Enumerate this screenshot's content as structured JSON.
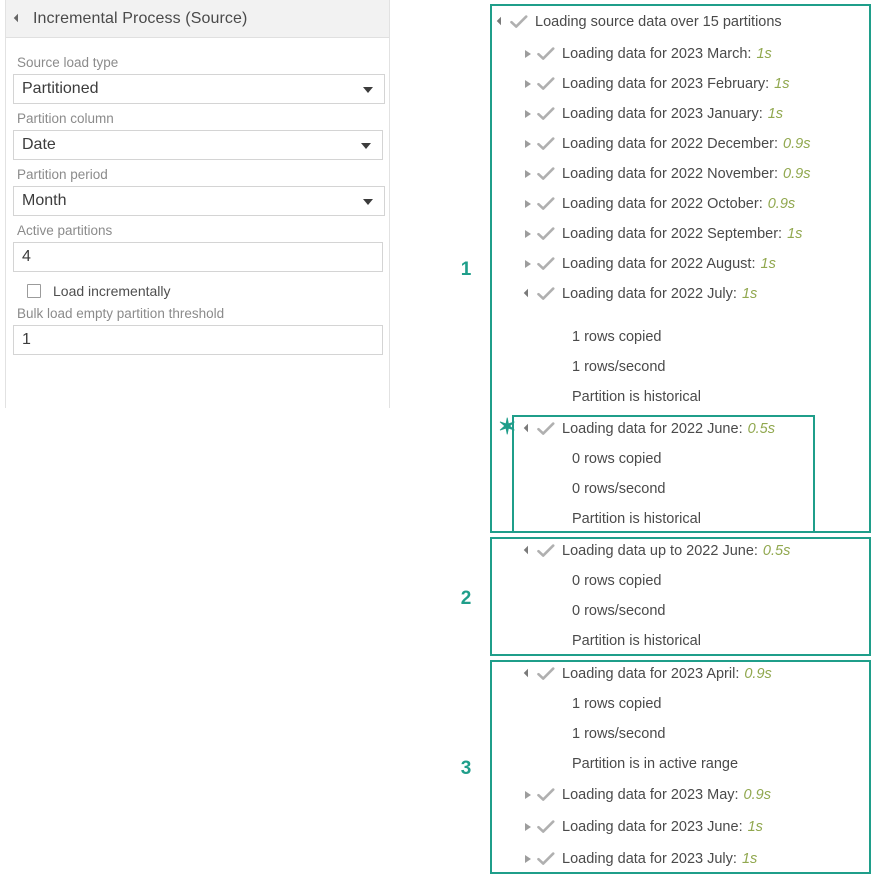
{
  "colors": {
    "accent": "#1f9e8a",
    "duration_text": "#91a84f",
    "label_text": "#8b8b8b",
    "body_text": "#4a4a4a",
    "header_bg": "#f2f2f2",
    "checkmark": "#b0b0b0"
  },
  "panel": {
    "title": "Incremental Process (Source)",
    "collapse_icon": "triangle-down-icon",
    "fields": [
      {
        "label": "Source load type",
        "value": "Partitioned",
        "type": "select"
      },
      {
        "label": "Partition column",
        "value": "Date",
        "type": "select"
      },
      {
        "label": "Partition period",
        "value": "Month",
        "type": "select"
      },
      {
        "label": "Active partitions",
        "value": "4",
        "type": "text"
      }
    ],
    "checkbox": {
      "label": "Load incrementally",
      "checked": false
    },
    "threshold": {
      "label": "Bulk load empty partition threshold",
      "value": "1",
      "type": "text"
    }
  },
  "log": {
    "root": {
      "text": "Loading source data over 15 partitions",
      "duration": "",
      "expanded": true,
      "status_icon": "check-icon"
    },
    "group1_rows": [
      {
        "text": "Loading data for 2023 March:",
        "duration": "1s",
        "expanded": false
      },
      {
        "text": "Loading data for 2023 February:",
        "duration": "1s",
        "expanded": false
      },
      {
        "text": "Loading data for 2023 January:",
        "duration": "1s",
        "expanded": false
      },
      {
        "text": "Loading data for 2022 December:",
        "duration": "0.9s",
        "expanded": false
      },
      {
        "text": "Loading data for 2022 November:",
        "duration": "0.9s",
        "expanded": false
      },
      {
        "text": "Loading data for 2022 October:",
        "duration": "0.9s",
        "expanded": false
      },
      {
        "text": "Loading data for 2022 September:",
        "duration": "1s",
        "expanded": false
      },
      {
        "text": "Loading data for 2022 August:",
        "duration": "1s",
        "expanded": false
      },
      {
        "text": "Loading data for 2022 July:",
        "duration": "1s",
        "expanded": true
      }
    ],
    "july_details": [
      "1 rows copied",
      "1 rows/second",
      "Partition is historical"
    ],
    "june_row": {
      "text": "Loading data for 2022 June:",
      "duration": "0.5s",
      "expanded": true
    },
    "june_details": [
      "0 rows copied",
      "0 rows/second",
      "Partition is historical"
    ],
    "group2_row": {
      "text": "Loading data up to 2022 June:",
      "duration": "0.5s",
      "expanded": true
    },
    "group2_details": [
      "0 rows copied",
      "0 rows/second",
      "Partition is historical"
    ],
    "group3_row": {
      "text": "Loading data for 2023 April:",
      "duration": "0.9s",
      "expanded": true
    },
    "group3_details": [
      "1 rows copied",
      "1 rows/second",
      "Partition is in active range"
    ],
    "group3_rows": [
      {
        "text": "Loading data for 2023 May:",
        "duration": "0.9s",
        "expanded": false
      },
      {
        "text": "Loading data for 2023 June:",
        "duration": "1s",
        "expanded": false
      },
      {
        "text": "Loading data for 2023 July:",
        "duration": "1s",
        "expanded": false
      }
    ],
    "markers": {
      "one": "1",
      "two": "2",
      "three": "3",
      "asterisk": "✶"
    }
  }
}
